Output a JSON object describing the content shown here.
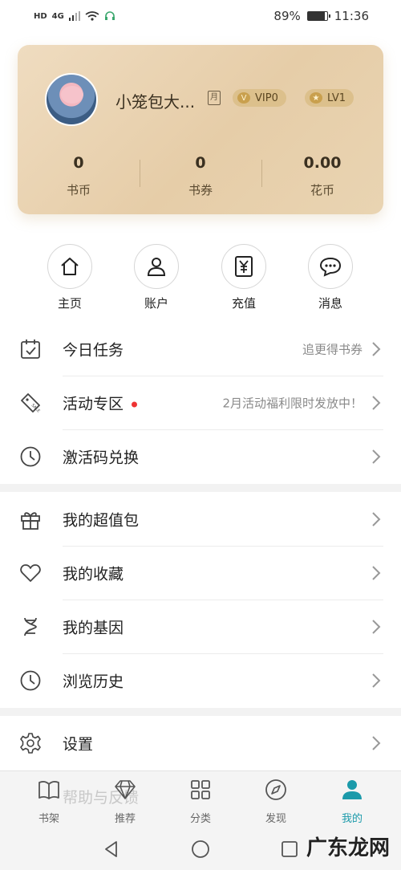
{
  "status_bar": {
    "network_label": "HD",
    "signal_label": "4G",
    "battery_percent": "89%",
    "battery_level": 0.89,
    "time": "11:36"
  },
  "profile": {
    "username": "小笼包大...",
    "month_badge": "月",
    "vip_label": "VIP0",
    "level_label": "LV1",
    "stats": [
      {
        "value": "0",
        "label": "书币"
      },
      {
        "value": "0",
        "label": "书券"
      },
      {
        "value": "0.00",
        "label": "花币"
      }
    ]
  },
  "quick_actions": [
    {
      "label": "主页",
      "icon": "home-icon"
    },
    {
      "label": "账户",
      "icon": "user-icon"
    },
    {
      "label": "充值",
      "icon": "yuan-icon"
    },
    {
      "label": "消息",
      "icon": "message-icon"
    }
  ],
  "menu_group_1": [
    {
      "label": "今日任务",
      "hint": "追更得书券",
      "icon": "calendar-check-icon"
    },
    {
      "label": "活动专区",
      "hint": "2月活动福利限时发放中！",
      "icon": "sale-tag-icon",
      "dot": true
    },
    {
      "label": "激活码兑换",
      "hint": "",
      "icon": "clock-icon"
    }
  ],
  "menu_group_2": [
    {
      "label": "我的超值包",
      "icon": "gift-icon"
    },
    {
      "label": "我的收藏",
      "icon": "heart-icon"
    },
    {
      "label": "我的基因",
      "icon": "dna-icon"
    },
    {
      "label": "浏览历史",
      "icon": "history-clock-icon"
    }
  ],
  "menu_group_3": [
    {
      "label": "设置",
      "icon": "gear-icon"
    }
  ],
  "hidden_row": {
    "label": "帮助与反馈"
  },
  "bottom_nav": [
    {
      "label": "书架",
      "icon": "book-icon",
      "active": false
    },
    {
      "label": "推荐",
      "icon": "diamond-icon",
      "active": false
    },
    {
      "label": "分类",
      "icon": "grid-icon",
      "active": false
    },
    {
      "label": "发现",
      "icon": "compass-icon",
      "active": false
    },
    {
      "label": "我的",
      "icon": "person-icon",
      "active": true
    }
  ],
  "accent_color": "#1b9aaa",
  "watermark": "广东龙网"
}
